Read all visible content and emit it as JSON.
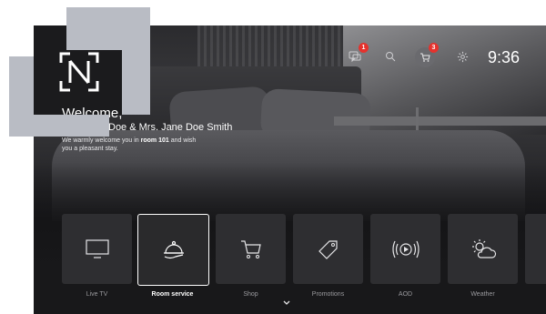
{
  "header": {
    "clock": "9:36",
    "chat_badge": "1",
    "cart_badge": "3"
  },
  "welcome": {
    "title": "Welcome,",
    "names": "Doe & Mrs. Jane Doe Smith",
    "message_pre": "We warmly welcome you in ",
    "room": "room 101",
    "message_post": " and wish you a pleasant stay."
  },
  "tiles": [
    {
      "label": "Live TV",
      "icon": "tv-icon"
    },
    {
      "label": "Room service",
      "icon": "room-service-icon"
    },
    {
      "label": "Shop",
      "icon": "cart-icon"
    },
    {
      "label": "Promotions",
      "icon": "tag-icon"
    },
    {
      "label": "AOD",
      "icon": "audio-play-icon"
    },
    {
      "label": "Weather",
      "icon": "weather-icon"
    }
  ],
  "colors": {
    "accent": "#ffffff",
    "badge": "#e5322d",
    "tile": "#2e2e31",
    "logo_block": "#b9bcc4"
  }
}
